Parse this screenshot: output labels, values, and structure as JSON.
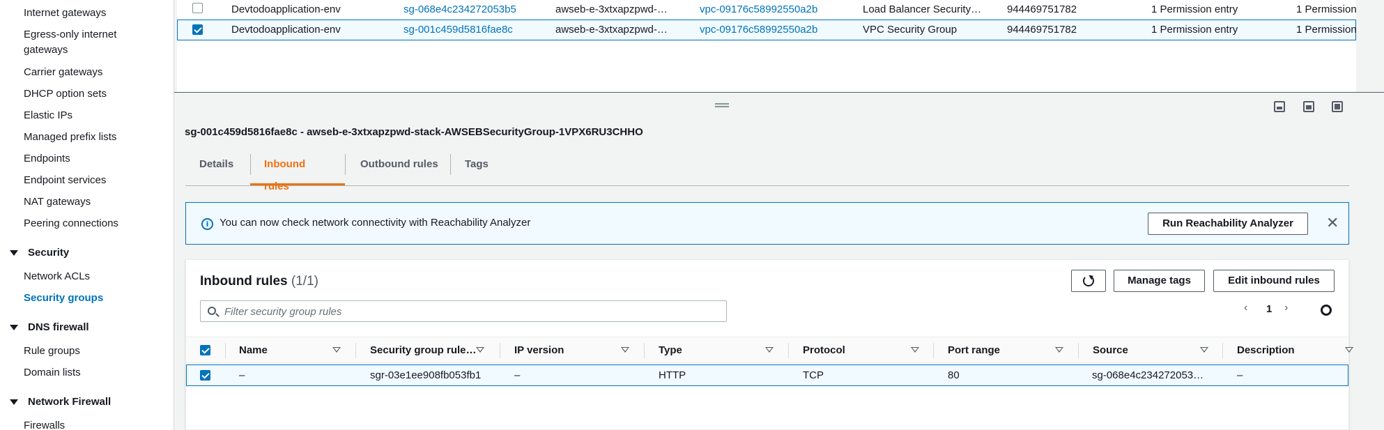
{
  "sidebar": {
    "items_top": [
      {
        "label": "Internet gateways"
      },
      {
        "label": "Egress-only internet gateways"
      },
      {
        "label": "Carrier gateways"
      },
      {
        "label": "DHCP option sets"
      },
      {
        "label": "Elastic IPs"
      },
      {
        "label": "Managed prefix lists"
      },
      {
        "label": "Endpoints"
      },
      {
        "label": "Endpoint services"
      },
      {
        "label": "NAT gateways"
      },
      {
        "label": "Peering connections"
      }
    ],
    "security": {
      "heading": "Security",
      "items": [
        {
          "label": "Network ACLs"
        },
        {
          "label": "Security groups"
        }
      ]
    },
    "dns_firewall": {
      "heading": "DNS firewall",
      "items": [
        {
          "label": "Rule groups"
        },
        {
          "label": "Domain lists"
        }
      ]
    },
    "network_firewall": {
      "heading": "Network Firewall",
      "items": [
        {
          "label": "Firewalls"
        }
      ]
    }
  },
  "top_table": {
    "rows": [
      {
        "name": "Devtodoapplication-env",
        "sg_id": "sg-068e4c234272053b5",
        "sg_name": "awseb-e-3xtxapzpwd-…",
        "vpc_id": "vpc-09176c58992550a2b",
        "description": "Load Balancer Security…",
        "owner": "944469751782",
        "inbound": "1 Permission entry",
        "outbound": "1 Permission",
        "checked": false
      },
      {
        "name": "Devtodoapplication-env",
        "sg_id": "sg-001c459d5816fae8c",
        "sg_name": "awseb-e-3xtxapzpwd-…",
        "vpc_id": "vpc-09176c58992550a2b",
        "description": "VPC Security Group",
        "owner": "944469751782",
        "inbound": "1 Permission entry",
        "outbound": "1 Permission",
        "checked": true
      }
    ]
  },
  "detail": {
    "title": "sg-001c459d5816fae8c - awseb-e-3xtxapzpwd-stack-AWSEBSecurityGroup-1VPX6RU3CHHO",
    "tabs": [
      {
        "label": "Details"
      },
      {
        "label": "Inbound rules"
      },
      {
        "label": "Outbound rules"
      },
      {
        "label": "Tags"
      }
    ],
    "active_tab": "Inbound rules"
  },
  "alert": {
    "icon": "info-icon",
    "text": "You can now check network connectivity with Reachability Analyzer",
    "button": "Run Reachability Analyzer",
    "close": "✕"
  },
  "rules": {
    "title": "Inbound rules",
    "count": "(1/1)",
    "buttons": {
      "manage_tags": "Manage tags",
      "edit": "Edit inbound rules"
    },
    "filter_placeholder": "Filter security group rules",
    "page": "1",
    "columns": [
      "Name",
      "Security group rule…",
      "IP version",
      "Type",
      "Protocol",
      "Port range",
      "Source",
      "Description"
    ],
    "row": {
      "name": "–",
      "rule_id": "sgr-03e1ee908fb053fb1",
      "ip_version": "–",
      "type": "HTTP",
      "protocol": "TCP",
      "port_range": "80",
      "source": "sg-068e4c234272053…",
      "description": "–",
      "checked": true
    }
  },
  "colors": {
    "accent": "#0073bb",
    "tab_active": "#ec7211"
  }
}
